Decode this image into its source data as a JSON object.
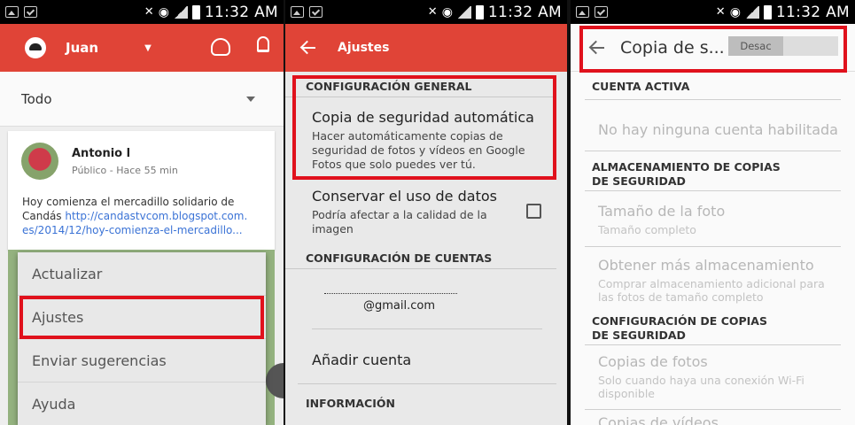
{
  "status_bar": {
    "time": "11:32 AM"
  },
  "panel1": {
    "user_name": "Juan",
    "filter_label": "Todo",
    "post": {
      "author": "Antonio l",
      "meta": "Público - Hace 55 min",
      "text_line1": "Hoy comienza el mercadillo solidario de",
      "text_prefix": "Candás",
      "link_part1": "http://candastvcom.blogspot.com.",
      "link_part2": "es/2014/12/hoy-comienza-el-mercadillo..."
    },
    "menu": [
      "Actualizar",
      "Ajustes",
      "Enviar sugerencias",
      "Ayuda"
    ]
  },
  "panel2": {
    "title": "Ajustes",
    "section_general": "CONFIGURACIÓN GENERAL",
    "backup_title": "Copia de seguridad automática",
    "backup_desc": "Hacer automáticamente copias de seguridad de fotos y vídeos en Google Fotos que solo puedes ver tú.",
    "data_title": "Conservar el uso de datos",
    "data_desc": "Podría afectar a la calidad de la imagen",
    "section_accounts": "CONFIGURACIÓN DE CUENTAS",
    "account_email": "@gmail.com",
    "add_account": "Añadir cuenta",
    "section_info": "INFORMACIÓN"
  },
  "panel3": {
    "title": "Copia de s...",
    "toggle_label": "Desac",
    "section_active": "CUENTA ACTIVA",
    "no_account": "No hay ninguna cuenta habilitada",
    "section_storage": "ALMACENAMIENTO DE COPIAS DE SEGURIDAD",
    "photo_size_title": "Tamaño de la foto",
    "photo_size_sub": "Tamaño completo",
    "more_storage_title": "Obtener más almacenamiento",
    "more_storage_sub": "Comprar almacenamiento adicional para las fotos de tamaño completo",
    "section_backup_cfg": "CONFIGURACIÓN DE COPIAS DE SEGURIDAD",
    "photo_copies_title": "Copias de fotos",
    "photo_copies_sub": "Solo cuando haya una conexión Wi-Fi disponible",
    "video_copies_title": "Copias de vídeos"
  },
  "colors": {
    "accent": "#e04437",
    "highlight": "#e0111c"
  }
}
